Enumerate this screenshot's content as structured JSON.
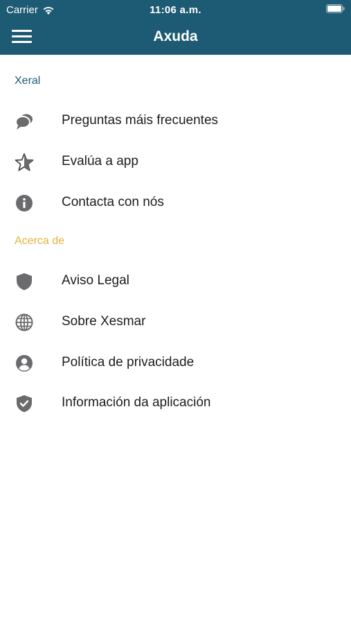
{
  "status_bar": {
    "carrier": "Carrier",
    "time": "11:06 a.m."
  },
  "header": {
    "title": "Axuda",
    "menu_icon": "hamburger-menu-icon"
  },
  "colors": {
    "header_bg": "#1d5a73",
    "section_general": "#1d5a73",
    "section_about": "#e2b23c",
    "icon": "#6b6b6e"
  },
  "sections": [
    {
      "title": "Xeral",
      "items": [
        {
          "label": "Preguntas máis frecuentes",
          "icon": "chat-bubbles-icon"
        },
        {
          "label": "Evalúa a app",
          "icon": "star-outline-icon"
        },
        {
          "label": "Contacta con nós",
          "icon": "info-icon"
        }
      ]
    },
    {
      "title": "Acerca de",
      "items": [
        {
          "label": "Aviso Legal",
          "icon": "shield-icon"
        },
        {
          "label": "Sobre Xesmar",
          "icon": "globe-icon"
        },
        {
          "label": "Política de privacidade",
          "icon": "user-circle-icon"
        },
        {
          "label": "Información da aplicación",
          "icon": "shield-check-icon"
        }
      ]
    }
  ]
}
